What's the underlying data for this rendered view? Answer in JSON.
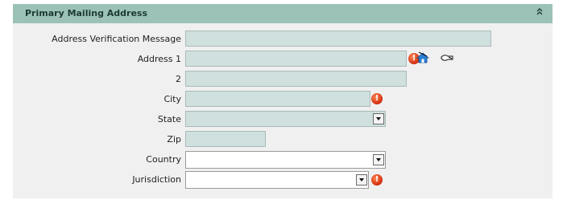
{
  "panel": {
    "title": "Primary Mailing Address",
    "collapse_glyph": "«",
    "colors": {
      "header_bg": "#9cc2b8",
      "field_bg": "#cfe0df",
      "error": "#d12a0a"
    }
  },
  "fields": [
    {
      "label": "Address Verification Message",
      "value": "",
      "type": "text"
    },
    {
      "label": "Address 1",
      "value": "",
      "type": "text",
      "error_icon": "!",
      "icons": [
        "house-map-icon",
        "zip-lookup-icon"
      ]
    },
    {
      "label": "2",
      "value": "",
      "type": "text"
    },
    {
      "label": "City",
      "value": "",
      "type": "text",
      "error_icon": "!"
    },
    {
      "label": "State",
      "value": "",
      "type": "select"
    },
    {
      "label": "Zip",
      "value": "",
      "type": "text"
    },
    {
      "label": "Country",
      "value": "",
      "type": "select"
    },
    {
      "label": "Jurisdiction",
      "value": "",
      "type": "select",
      "error_icon": "!"
    }
  ]
}
